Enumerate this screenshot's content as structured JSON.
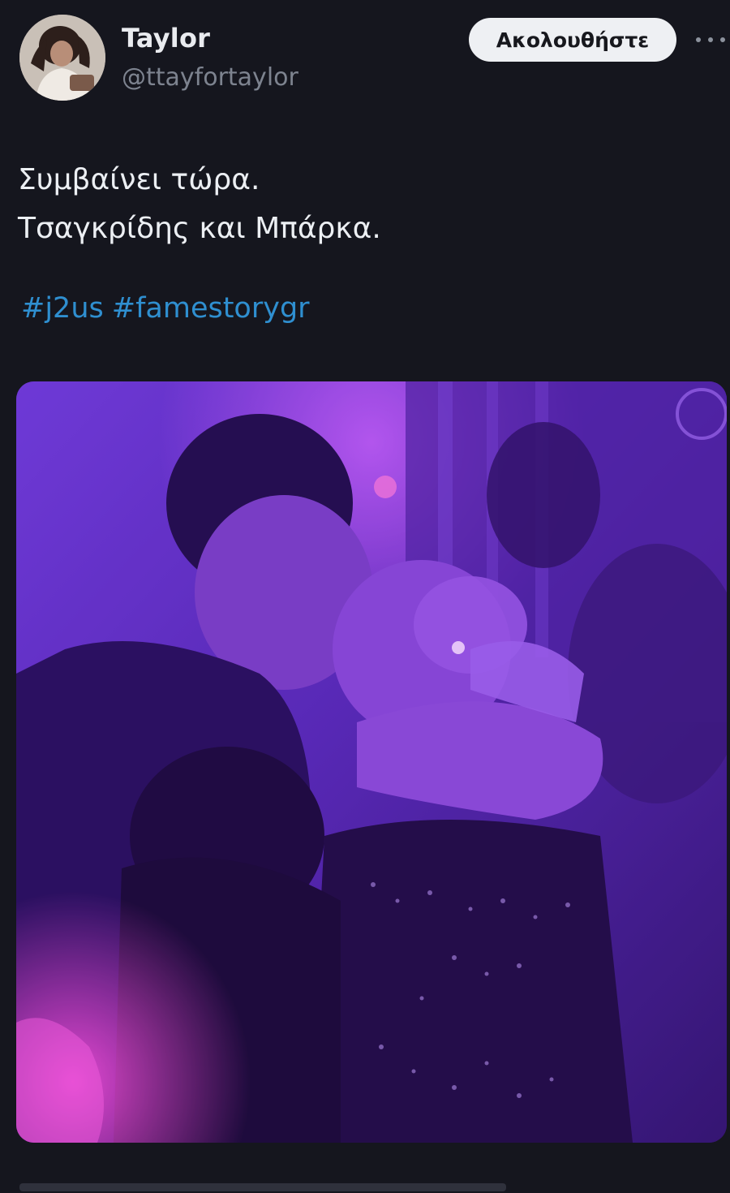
{
  "tweet": {
    "author_name": "Taylor",
    "author_handle": "@ttayfortaylor",
    "follow_label": "Ακολουθήστε",
    "more_icon": "more-horizontal-icon",
    "text_lines": [
      "Συμβαίνει τώρα.",
      "Τσαγκρίδης και Μπάρκα."
    ],
    "hashtags": [
      "#j2us",
      "#famestorygr"
    ],
    "media": {
      "type": "video-still"
    }
  },
  "colors": {
    "background": "#15161e",
    "text": "#eceff3",
    "secondary_text": "#7d838f",
    "link": "#2f8fd0",
    "follow_button_bg": "#eef0f3",
    "media_tint": "#6a2fd0"
  }
}
